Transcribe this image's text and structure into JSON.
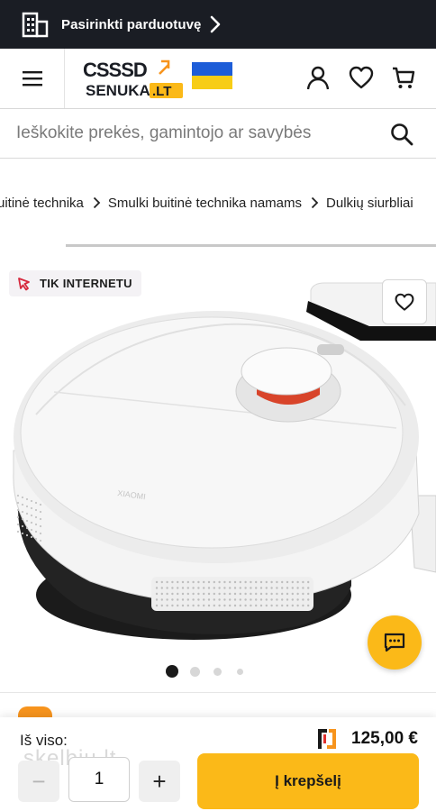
{
  "store_bar": {
    "label": "Pasirinkti parduotuvę",
    "icon": "building-icon"
  },
  "header": {
    "logo_text_top": "CSSSD",
    "logo_text_bottom": "SENUKAI",
    "logo_text_tld": ".LT",
    "icons": [
      "menu-icon",
      "user-icon",
      "heart-icon",
      "cart-icon"
    ],
    "flag": "ukraine-flag"
  },
  "search": {
    "placeholder": "Ieškokite prekės, gamintojo ar savybės"
  },
  "breadcrumb": {
    "items": [
      "uitinė technika",
      "Smulki buitinė technika namams",
      "Dulkių siurbliai"
    ]
  },
  "badge": {
    "label": "TIK INTERNETU"
  },
  "product": {
    "image": "robot-vacuum-image",
    "gallery_dots": 4,
    "active_dot": 1
  },
  "bottom_bar": {
    "total_label": "Iš viso:",
    "price": "125,00 €",
    "quantity": "1",
    "minus_label": "−",
    "plus_label": "+",
    "add_to_cart": "Į krepšelį",
    "watermark": "skelbiu.lt"
  },
  "colors": {
    "accent": "#fbb918",
    "dark_bar": "#1a1d24",
    "brand_red": "#e1312f",
    "brand_blue": "#1d5dd8"
  }
}
